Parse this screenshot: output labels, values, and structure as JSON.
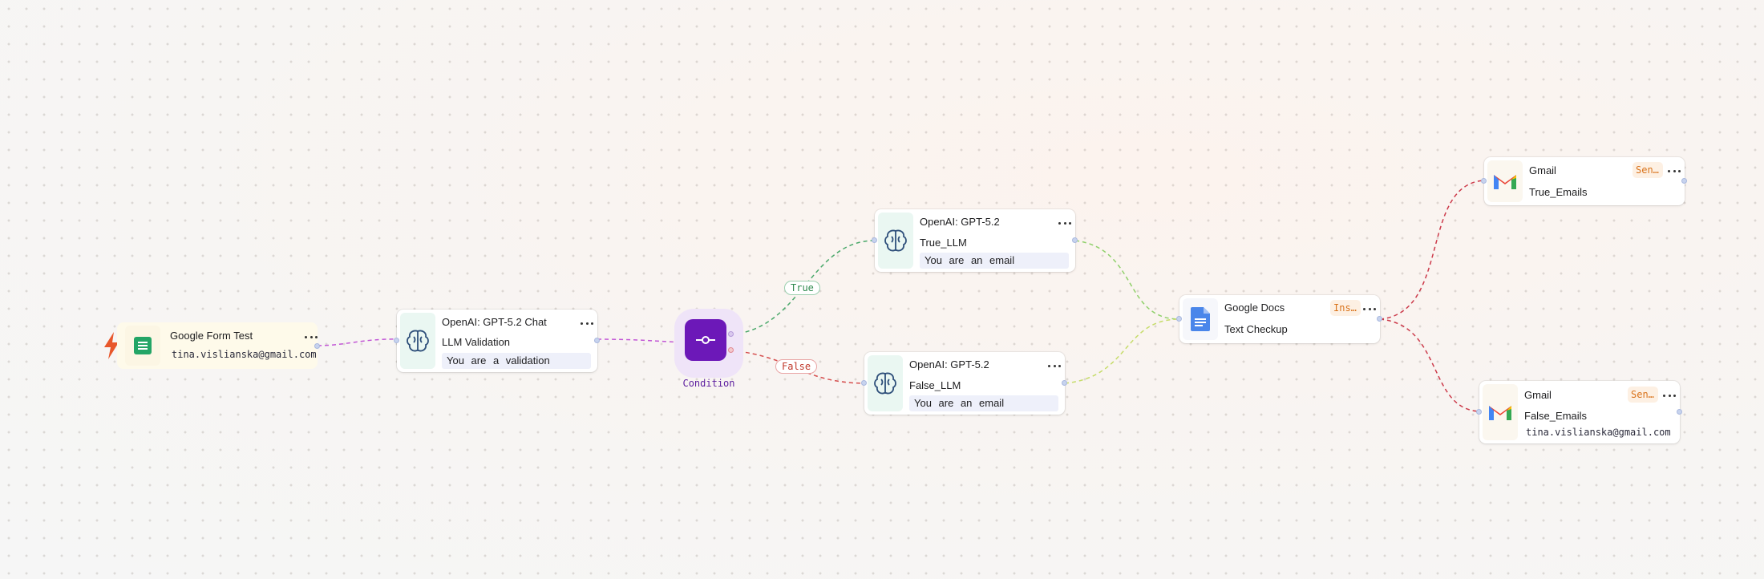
{
  "colors": {
    "canvas_bg": "#f8f6f4",
    "condition_purple": "#6c18b8",
    "true_green": "#2f8a4e",
    "false_red": "#c0392b",
    "badge_orange": "#d9731b"
  },
  "nodes": {
    "google_form": {
      "icon": "google-sheets-icon",
      "trigger_icon": "lightning-bolt-icon",
      "title": "Google Form Test",
      "email": "tina.vislianska@gmail.com"
    },
    "llm_validation": {
      "icon": "brain-icon",
      "title": "OpenAI: GPT-5.2 Chat",
      "name": "LLM Validation",
      "prompt": "You are a validation"
    },
    "condition": {
      "icon": "condition-icon",
      "label": "Condition",
      "true_label": "True",
      "false_label": "False"
    },
    "true_llm": {
      "icon": "brain-icon",
      "title": "OpenAI: GPT-5.2",
      "name": "True_LLM",
      "prompt": "You are an email"
    },
    "false_llm": {
      "icon": "brain-icon",
      "title": "OpenAI: GPT-5.2",
      "name": "False_LLM",
      "prompt": "You are an email"
    },
    "google_docs": {
      "icon": "google-docs-icon",
      "title": "Google Docs",
      "badge": "Ins…",
      "name": "Text Checkup"
    },
    "gmail_true": {
      "icon": "gmail-icon",
      "title": "Gmail",
      "badge": "Sen…",
      "name": "True_Emails"
    },
    "gmail_false": {
      "icon": "gmail-icon",
      "title": "Gmail",
      "badge": "Sen…",
      "name": "False_Emails",
      "email": "tina.vislianska@gmail.com"
    }
  }
}
